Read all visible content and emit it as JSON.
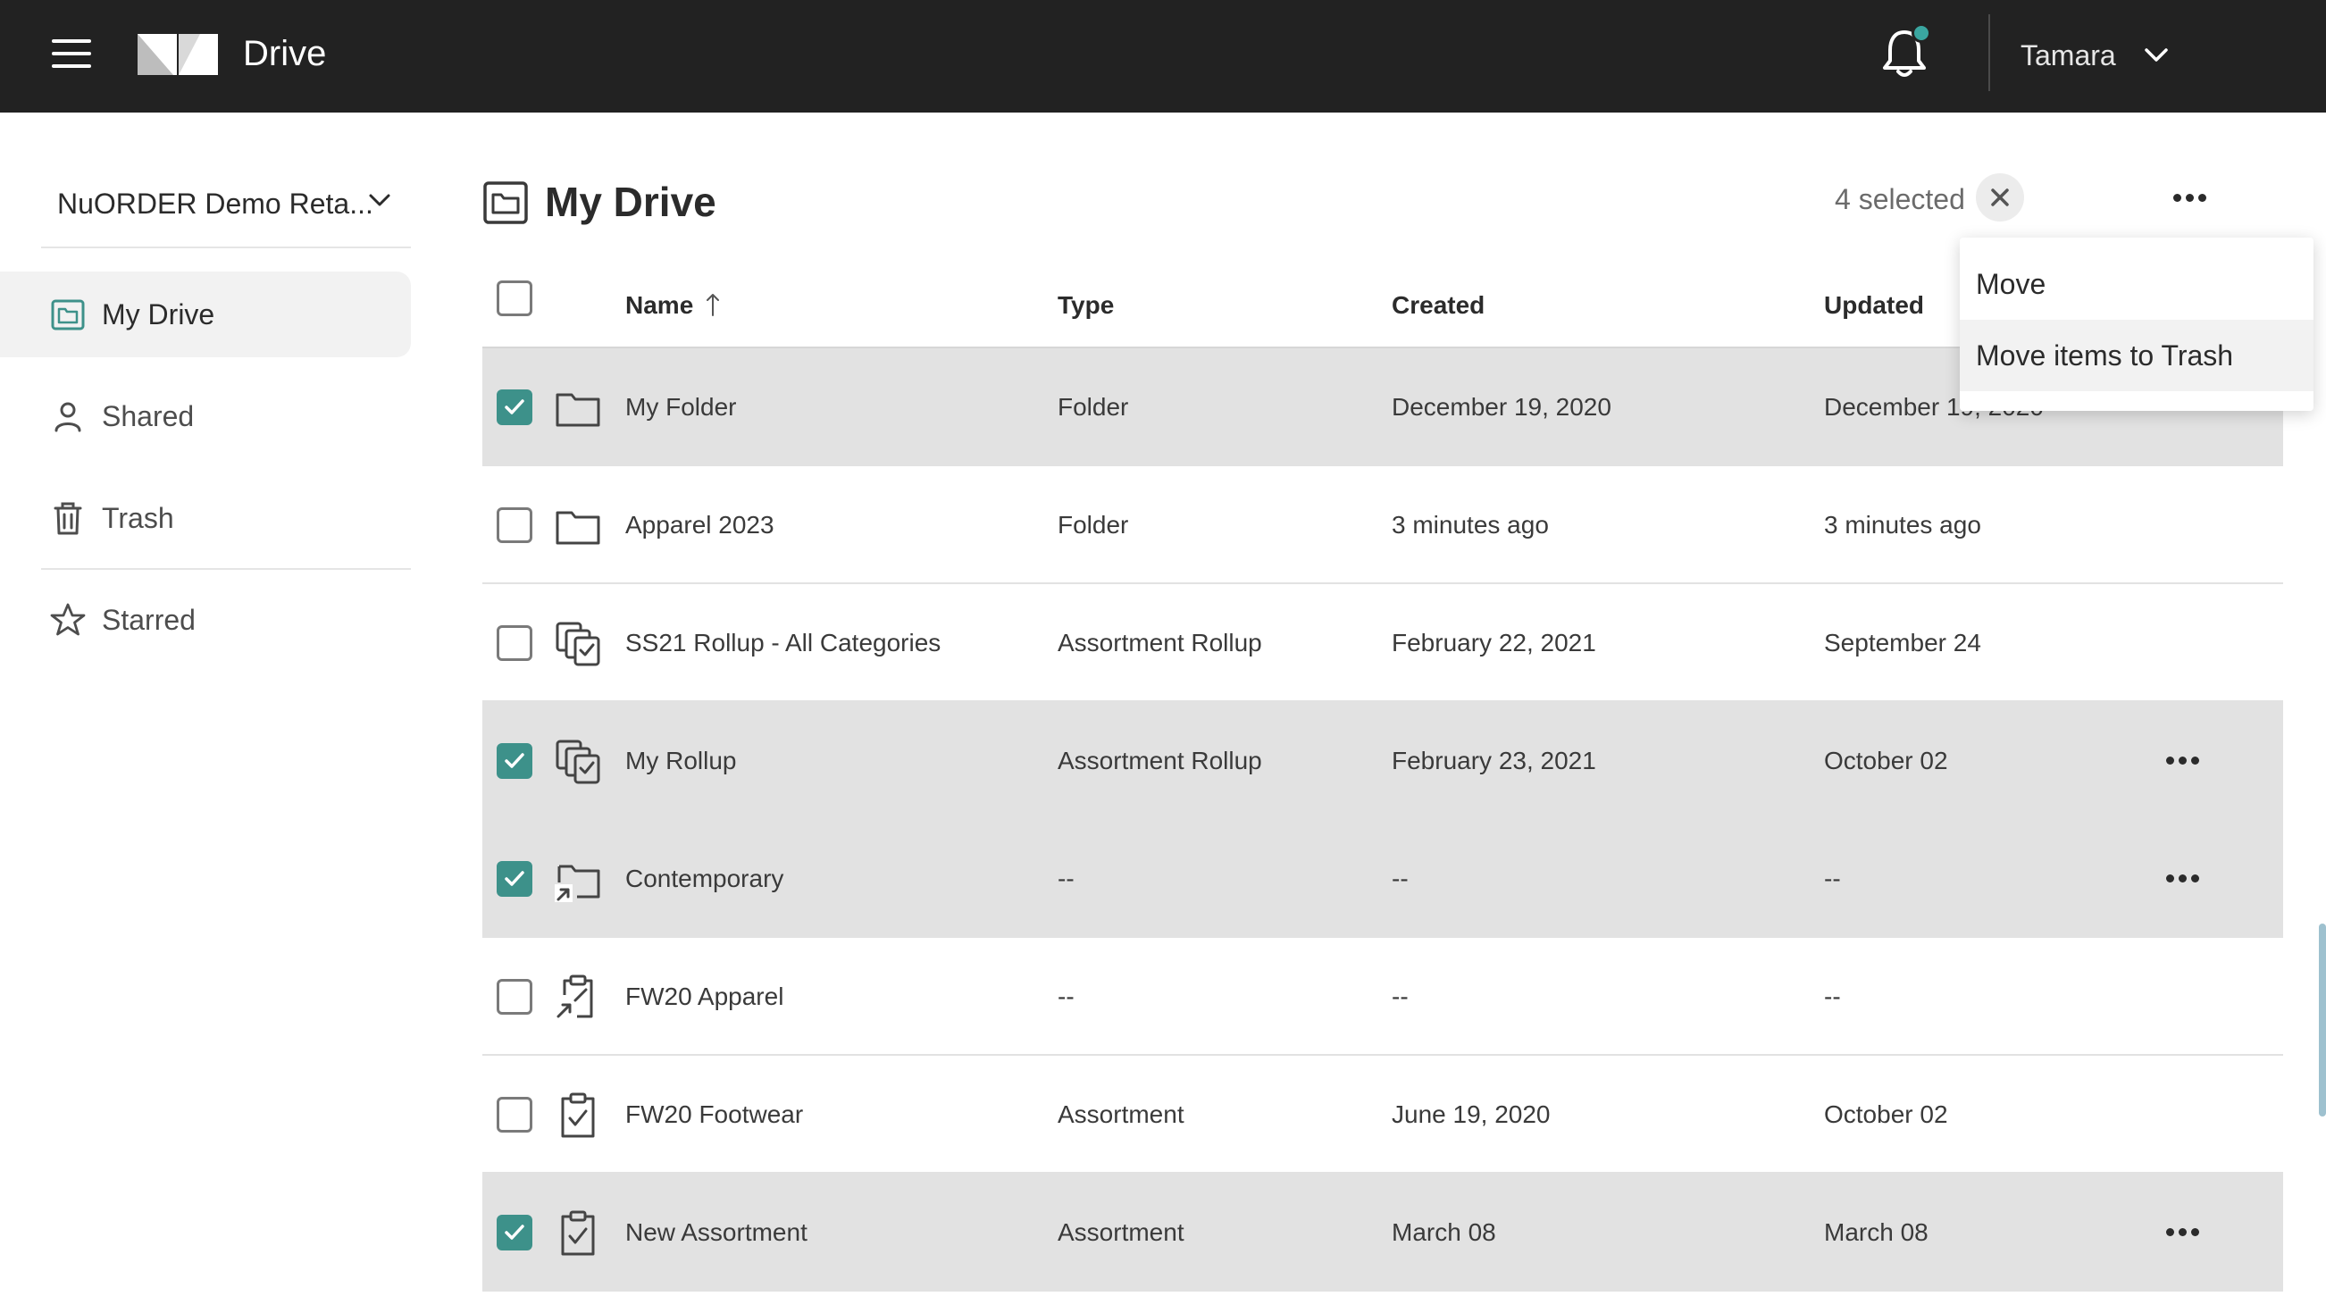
{
  "app": {
    "title": "Drive",
    "accent": "#3d918a"
  },
  "user": {
    "name": "Tamara"
  },
  "sidebar": {
    "workspace": "NuORDER Demo Reta...",
    "items": [
      {
        "label": "My Drive",
        "icon": "drive-folder-icon",
        "active": true
      },
      {
        "label": "Shared",
        "icon": "person-icon"
      },
      {
        "label": "Trash",
        "icon": "trash-icon"
      },
      {
        "label": "Starred",
        "icon": "star-icon"
      }
    ]
  },
  "main": {
    "title": "My Drive",
    "selected_count": "4 selected",
    "columns": {
      "name": "Name",
      "type": "Type",
      "created": "Created",
      "updated": "Updated"
    },
    "rows": [
      {
        "name": "My Folder",
        "type": "Folder",
        "created": "December 19, 2020",
        "updated": "December 19, 2020",
        "selected": true,
        "icon": "folder-icon"
      },
      {
        "name": "Apparel 2023",
        "type": "Folder",
        "created": "3 minutes ago",
        "updated": "3 minutes ago",
        "selected": false,
        "icon": "folder-icon"
      },
      {
        "name": "SS21 Rollup - All Categories",
        "type": "Assortment Rollup",
        "created": "February 22, 2021",
        "updated": "September 24",
        "selected": false,
        "icon": "rollup-icon"
      },
      {
        "name": "My Rollup",
        "type": "Assortment Rollup",
        "created": "February 23, 2021",
        "updated": "October 02",
        "selected": true,
        "icon": "rollup-icon"
      },
      {
        "name": "Contemporary",
        "type": "--",
        "created": "--",
        "updated": "--",
        "selected": true,
        "icon": "shortcut-folder-icon"
      },
      {
        "name": "FW20 Apparel",
        "type": "--",
        "created": "--",
        "updated": "--",
        "selected": false,
        "icon": "shortcut-assortment-icon"
      },
      {
        "name": "FW20 Footwear",
        "type": "Assortment",
        "created": "June 19, 2020",
        "updated": "October 02",
        "selected": false,
        "icon": "assortment-icon"
      },
      {
        "name": "New Assortment",
        "type": "Assortment",
        "created": "March 08",
        "updated": "March 08",
        "selected": true,
        "icon": "assortment-icon"
      }
    ]
  },
  "menu": {
    "items": [
      {
        "label": "Move"
      },
      {
        "label": "Move items to Trash"
      }
    ]
  }
}
